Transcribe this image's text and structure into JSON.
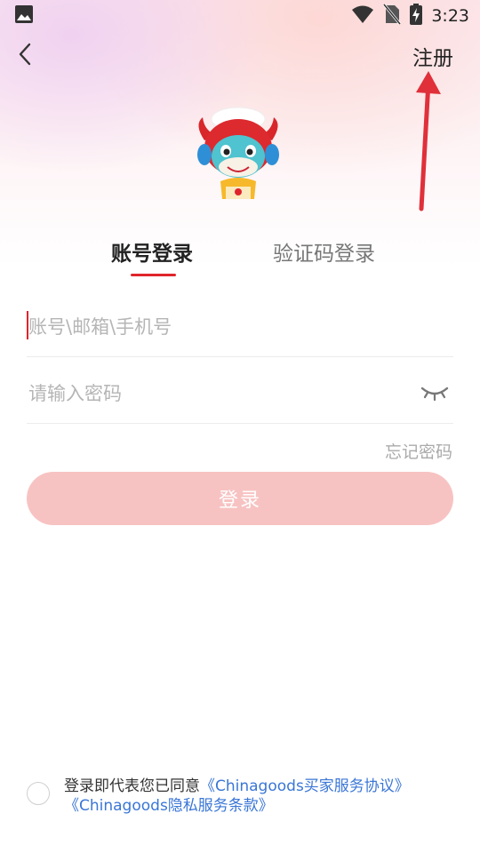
{
  "status_bar": {
    "time": "3:23"
  },
  "nav": {
    "register_label": "注册"
  },
  "tabs": [
    {
      "label": "账号登录",
      "active": true
    },
    {
      "label": "验证码登录",
      "active": false
    }
  ],
  "form": {
    "account_placeholder": "账号\\邮箱\\手机号",
    "account_value": "",
    "password_placeholder": "请输入密码",
    "password_value": "",
    "forgot_label": "忘记密码",
    "login_label": "登录"
  },
  "agreement": {
    "prefix": "登录即代表您已同意",
    "link_buyer": "《Chinagoods买家服务协议》",
    "link_privacy": "《Chinagoods隐私服务条款》",
    "checked": false
  },
  "colors": {
    "accent_red": "#e0242b",
    "button_disabled": "#f7c3c2",
    "link_blue": "#3a76d6",
    "annotation_arrow": "#e0303a"
  }
}
